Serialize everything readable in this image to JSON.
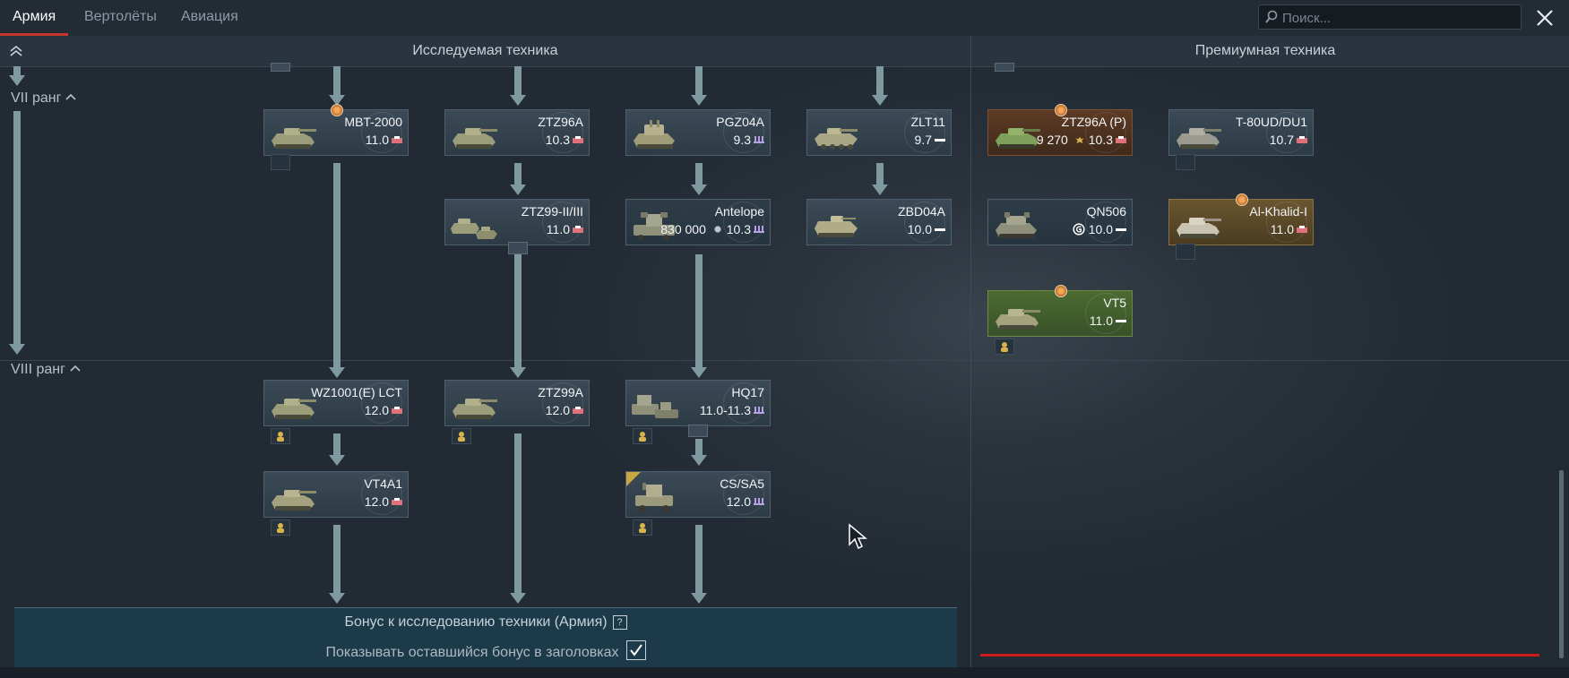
{
  "tabs": [
    {
      "label": "Армия",
      "active": true
    },
    {
      "label": "Вертолёты",
      "active": false
    },
    {
      "label": "Авиация",
      "active": false
    }
  ],
  "search": {
    "placeholder": "Поиск..."
  },
  "header": {
    "researched_title": "Исследуемая техника",
    "premium_title": "Премиумная техника"
  },
  "ranks": {
    "r7": "VII ранг",
    "r8": "VIII ранг"
  },
  "vehicles": {
    "mbt2000": {
      "name": "MBT-2000",
      "br": "11.0",
      "role": "tank-red"
    },
    "ztz96a": {
      "name": "ZTZ96A",
      "br": "10.3",
      "role": "tank-red"
    },
    "pgz04a": {
      "name": "PGZ04A",
      "br": "9.3",
      "role": "spaa-purple"
    },
    "zlt11": {
      "name": "ZLT11",
      "br": "9.7",
      "role": "light-white"
    },
    "ztz99ii": {
      "name": "ZTZ99-II/III",
      "br": "11.0",
      "role": "tank-red"
    },
    "antelope": {
      "name": "Antelope",
      "price": "830 000",
      "br": "10.3",
      "role": "spaa-purple"
    },
    "zbd04a": {
      "name": "ZBD04A",
      "br": "10.0",
      "role": "light-white"
    },
    "wz1001": {
      "name": "WZ1001(E) LCT",
      "br": "12.0",
      "role": "tank-red"
    },
    "ztz99a": {
      "name": "ZTZ99A",
      "br": "12.0",
      "role": "tank-red"
    },
    "hq17": {
      "name": "HQ17",
      "br": "11.0-11.3",
      "role": "spaa-purple"
    },
    "vt4a1": {
      "name": "VT4A1",
      "br": "12.0",
      "role": "tank-red"
    },
    "cssa5": {
      "name": "CS/SA5",
      "br": "12.0",
      "role": "spaa-purple"
    },
    "ztz96ap": {
      "name": "ZTZ96A (P)",
      "price": "9 270",
      "br": "10.3",
      "role": "tank-red"
    },
    "t80ud": {
      "name": "T-80UD/DU1",
      "br": "10.7",
      "role": "tank-red"
    },
    "qn506": {
      "name": "QN506",
      "br": "10.0",
      "role": "light-white"
    },
    "alkhalid": {
      "name": "Al-Khalid-I",
      "br": "11.0",
      "role": "tank-red"
    },
    "vt5": {
      "name": "VT5",
      "br": "11.0",
      "role": "light-white"
    }
  },
  "bonus": {
    "title": "Бонус к исследованию техники (Армия)",
    "help": "?",
    "show_label": "Показывать оставшийся бонус в заголовках",
    "show_checked": true
  },
  "colors": {
    "accent_red": "#c4372c",
    "tank_red": "#e0707a",
    "spaa_purple": "#b7a0e6",
    "light_white": "#ffffff",
    "gold": "#d9b24a"
  }
}
